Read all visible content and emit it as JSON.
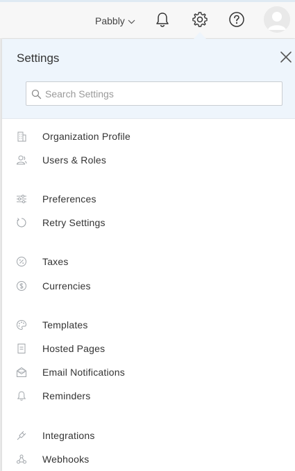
{
  "header": {
    "org_name": "Pabbly",
    "icons": [
      "bell-icon",
      "gear-icon",
      "help-icon",
      "avatar"
    ]
  },
  "settings": {
    "title": "Settings",
    "search_placeholder": "Search Settings",
    "items": [
      {
        "label": "Organization Profile",
        "icon": "building-icon"
      },
      {
        "label": "Users & Roles",
        "icon": "users-icon"
      },
      {
        "label": "Preferences",
        "icon": "sliders-icon"
      },
      {
        "label": "Retry Settings",
        "icon": "retry-icon"
      },
      {
        "label": "Taxes",
        "icon": "percent-icon"
      },
      {
        "label": "Currencies",
        "icon": "dollar-icon"
      },
      {
        "label": "Templates",
        "icon": "palette-icon"
      },
      {
        "label": "Hosted Pages",
        "icon": "page-icon"
      },
      {
        "label": "Email Notifications",
        "icon": "email-icon"
      },
      {
        "label": "Reminders",
        "icon": "bell-icon"
      },
      {
        "label": "Integrations",
        "icon": "plug-icon"
      },
      {
        "label": "Webhooks",
        "icon": "webhook-icon"
      }
    ]
  },
  "colors": {
    "header_bg": "#f7f7f7",
    "panel_head_bg": "#eef5fc",
    "icon": "#9aa0a6",
    "text": "#333333"
  }
}
